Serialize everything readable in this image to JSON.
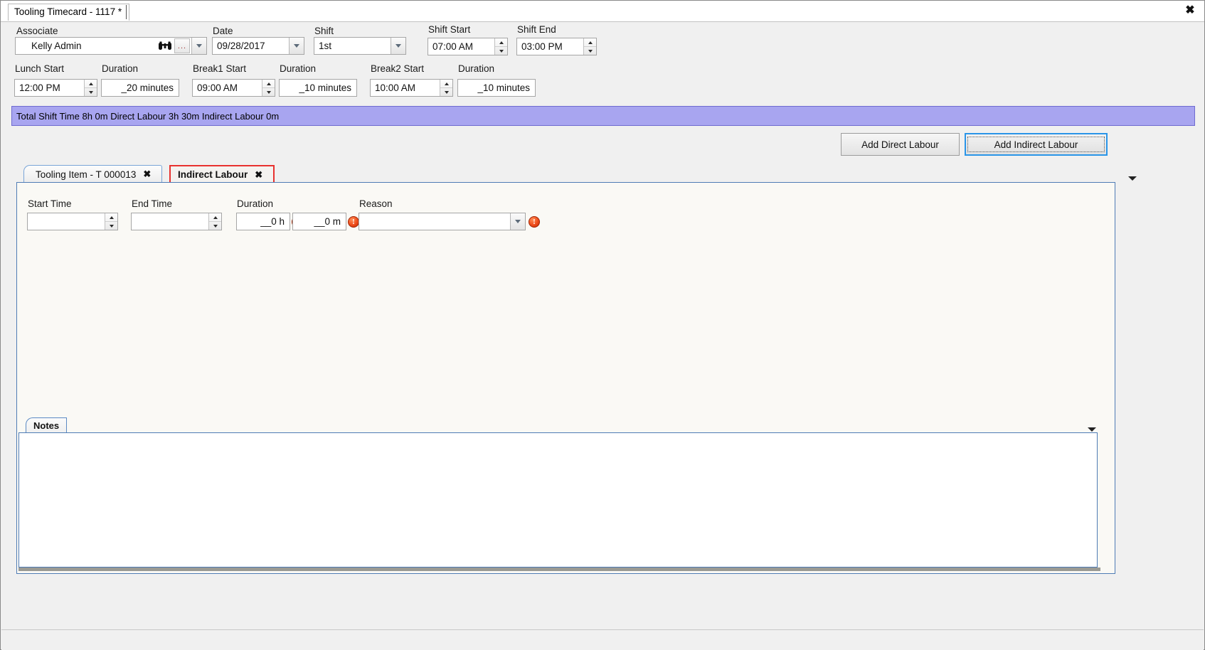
{
  "window": {
    "doc_tab_title": "Tooling Timecard - 1117 *",
    "close_icon": "close-icon",
    "close_glyph": "✖"
  },
  "header": {
    "associate": {
      "label": "Associate",
      "value": "Kelly Admin",
      "search_icon": "binoculars-icon",
      "ellipsis_label": "...",
      "dropdown_icon": "chevron-down-icon"
    },
    "date": {
      "label": "Date",
      "value": "09/28/2017",
      "dropdown_icon": "chevron-down-icon"
    },
    "shift": {
      "label": "Shift",
      "value": "1st",
      "dropdown_icon": "chevron-down-icon"
    },
    "shift_start": {
      "label": "Shift Start",
      "value": "07:00 AM"
    },
    "shift_end": {
      "label": "Shift End",
      "value": "03:00 PM"
    },
    "lunch_start": {
      "label": "Lunch Start",
      "value": "12:00 PM"
    },
    "lunch_duration": {
      "label": "Duration",
      "value": "_20 minutes"
    },
    "break1_start": {
      "label": "Break1 Start",
      "value": "09:00 AM"
    },
    "break1_duration": {
      "label": "Duration",
      "value": "_10 minutes"
    },
    "break2_start": {
      "label": "Break2 Start",
      "value": "10:00 AM"
    },
    "break2_duration": {
      "label": "Duration",
      "value": "_10 minutes"
    }
  },
  "summary": {
    "text": "Total Shift Time 8h 0m  Direct Labour 3h 30m  Indirect Labour 0m"
  },
  "actions": {
    "add_direct_labour": "Add Direct Labour",
    "add_indirect_labour": "Add Indirect Labour"
  },
  "tabs": [
    {
      "label": "Tooling Item - T 000013",
      "close_glyph": "✖",
      "active": false
    },
    {
      "label": "Indirect Labour",
      "close_glyph": "✖",
      "active": true
    }
  ],
  "tab_overflow_icon": "chevron-down-icon",
  "indirect_labour_form": {
    "start_time": {
      "label": "Start Time",
      "value": ""
    },
    "end_time": {
      "label": "End Time",
      "value": ""
    },
    "duration": {
      "label": "Duration",
      "hours_value": "__0 h",
      "minutes_value": "__0 m",
      "hours_error_glyph": "!",
      "minutes_error_glyph": "!"
    },
    "reason": {
      "label": "Reason",
      "value": "",
      "dropdown_icon": "chevron-down-icon",
      "error_glyph": "!"
    }
  },
  "notes": {
    "tab_label": "Notes",
    "value": "",
    "overflow_icon": "chevron-down-icon"
  },
  "colors": {
    "summary_bg": "#a8a5f0",
    "active_tab_border": "#e8312f",
    "focus_border": "#2a95e8",
    "error_icon": "#ee4d1c"
  }
}
